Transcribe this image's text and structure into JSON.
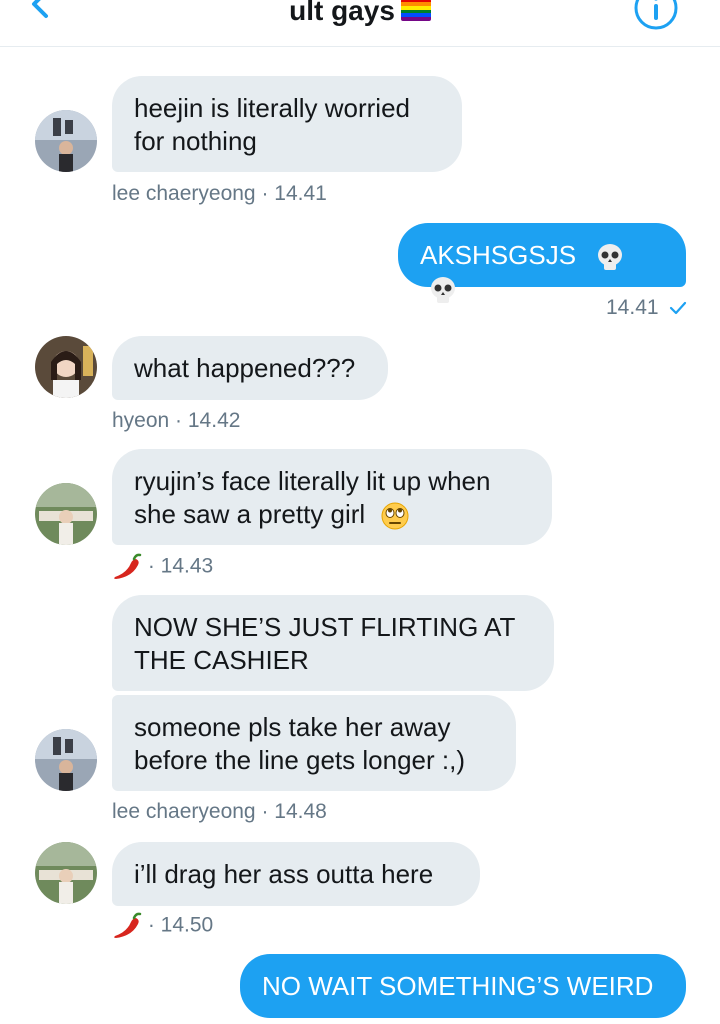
{
  "header": {
    "title": "ult gays",
    "flag_colors": [
      "#e40303",
      "#ff8c00",
      "#ffed00",
      "#008026",
      "#004dff",
      "#750787"
    ],
    "back_icon": "chevron-left-icon",
    "info_icon": "info-icon"
  },
  "colors": {
    "accent": "#1da1f2",
    "bubble_received": "#e6ecf0",
    "meta_text": "#657786"
  },
  "messages": [
    {
      "sender": "lee chaeryeong",
      "direction": "in",
      "text": "heejin is literally worried for nothing",
      "line1": "heejin is literally worried",
      "line2": "for nothing"
    },
    {
      "sender": "lee chaeryeong",
      "time": "14.41",
      "meta": "lee chaeryeong · 14.41"
    },
    {
      "direction": "out",
      "text": "AKSHSGSJS",
      "emoji": [
        "skull-icon",
        "skull-icon"
      ],
      "meta": "14.41",
      "status_icon": "check-icon"
    },
    {
      "sender": "hyeon",
      "direction": "in",
      "text": "what happened???",
      "meta": "hyeon · 14.42"
    },
    {
      "sender_icon": "chili-pepper-icon",
      "direction": "in",
      "line1": "ryujin’s face literally lit up when",
      "line2": "she saw a pretty girl",
      "emoji": "eye-roll-icon",
      "meta": "· 14.43"
    },
    {
      "direction": "in",
      "line1": "NOW SHE’S JUST FLIRTING AT",
      "line2": "THE CASHIER"
    },
    {
      "sender": "lee chaeryeong",
      "direction": "in",
      "line1": "someone pls take her away",
      "line2": "before the line gets longer :,)",
      "meta": "lee chaeryeong · 14.48"
    },
    {
      "sender_icon": "chili-pepper-icon",
      "direction": "in",
      "text": "i’ll drag her ass outta here",
      "meta": "· 14.50"
    },
    {
      "direction": "out",
      "text": "NO WAIT SOMETHING’S WEIRD"
    }
  ]
}
